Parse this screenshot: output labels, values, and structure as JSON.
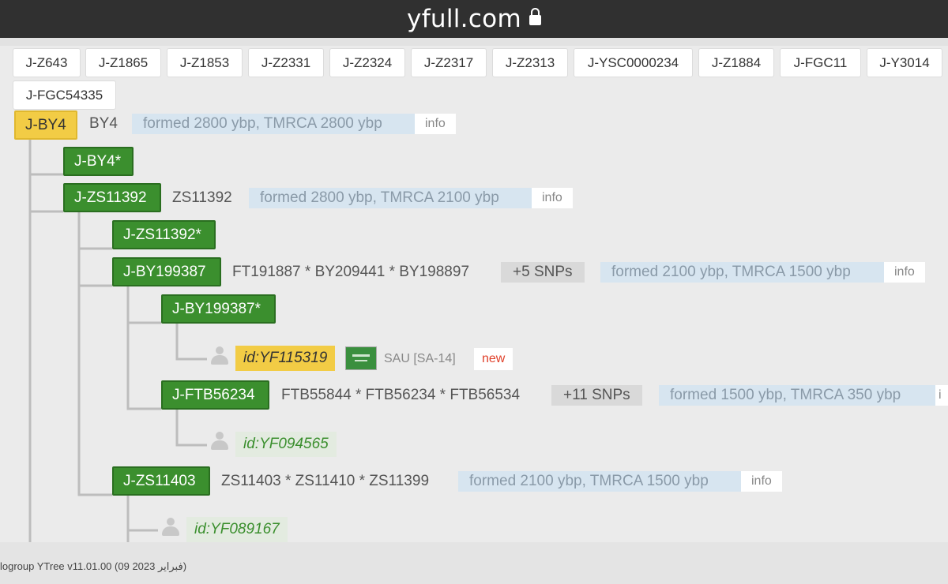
{
  "browser": {
    "domain": "yfull.com",
    "lock_icon": "lock-icon"
  },
  "tabs": [
    "J-Z643",
    "J-Z1865",
    "J-Z1853",
    "J-Z2331",
    "J-Z2324",
    "J-Z2317",
    "J-Z2313",
    "J-YSC0000234",
    "J-Z1884",
    "J-FGC11",
    "J-Y3014",
    "J-FGC54335"
  ],
  "tree": {
    "root": {
      "label": "J-BY4",
      "snps": "BY4",
      "formed": "formed 2800 ybp, TMRCA 2800 ybp",
      "info": "info"
    },
    "by4_star": {
      "label": "J-BY4*"
    },
    "zs11392": {
      "label": "J-ZS11392",
      "snps": "ZS11392",
      "formed": "formed 2800 ybp, TMRCA 2100 ybp",
      "info": "info"
    },
    "zs11392_star": {
      "label": "J-ZS11392*"
    },
    "by199387": {
      "label": "J-BY199387",
      "snps": "FT191887 * BY209441 * BY198897",
      "plus": "+5 SNPs",
      "formed": "formed 2100 ybp, TMRCA 1500 ybp",
      "info": "info"
    },
    "by199387_star": {
      "label": "J-BY199387*"
    },
    "kit1": {
      "id": "id:YF115319",
      "country": "SAU [SA-14]",
      "badge": "new"
    },
    "ftb56234": {
      "label": "J-FTB56234",
      "snps": "FTB55844 * FTB56234 * FTB56534",
      "plus": "+11 SNPs",
      "formed": "formed 1500 ybp, TMRCA 350 ybp",
      "info": "i"
    },
    "kit2": {
      "id": "id:YF094565"
    },
    "zs11403": {
      "label": "J-ZS11403",
      "snps": "ZS11403 * ZS11410 * ZS11399",
      "formed": "formed 2100 ybp, TMRCA 1500 ybp",
      "info": "info"
    },
    "kit3": {
      "id": "id:YF089167"
    }
  },
  "footer": "logroup YTree v11.01.00 (09 فبراير 2023)",
  "colors": {
    "node_green": "#3b8f2e",
    "node_yellow": "#f2cc45",
    "formed_bg": "#d7e5f0",
    "new_text": "#e0402a"
  }
}
